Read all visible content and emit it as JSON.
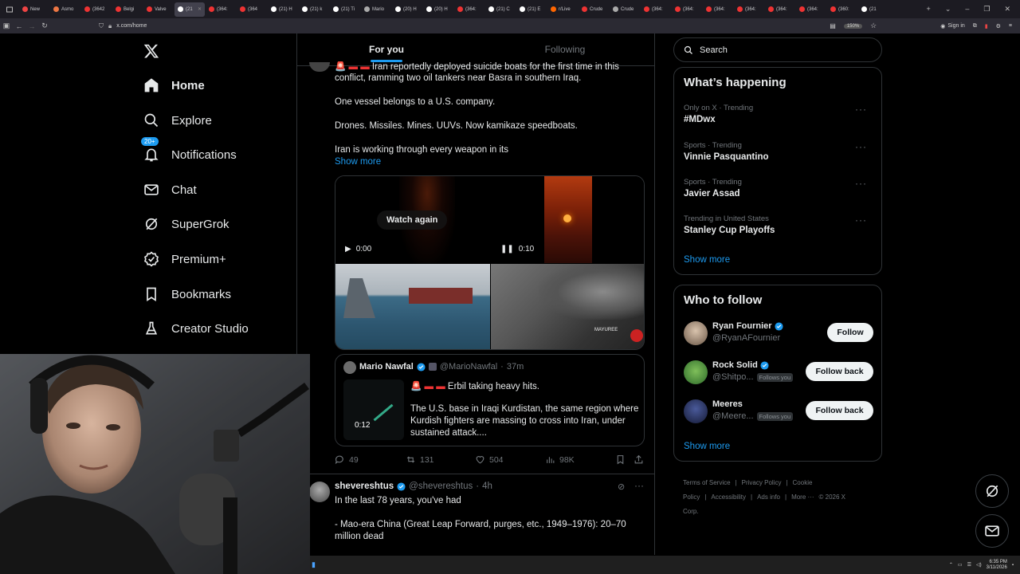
{
  "browser": {
    "tabs": [
      {
        "label": "New",
        "color": "#e44"
      },
      {
        "label": "Asmo",
        "color": "#e74"
      },
      {
        "label": "(3642",
        "color": "#e33"
      },
      {
        "label": "Belgi",
        "color": "#e33"
      },
      {
        "label": "Valve",
        "color": "#e33"
      },
      {
        "label": "(21",
        "color": "#fff",
        "active": true
      },
      {
        "label": "(364:",
        "color": "#e33"
      },
      {
        "label": "(364",
        "color": "#e33"
      },
      {
        "label": "(21) H",
        "color": "#fff"
      },
      {
        "label": "(21) k",
        "color": "#fff"
      },
      {
        "label": "(21) Ti",
        "color": "#fff"
      },
      {
        "label": "Mario",
        "color": "#aaa"
      },
      {
        "label": "(20) H",
        "color": "#fff"
      },
      {
        "label": "(20) H",
        "color": "#fff"
      },
      {
        "label": "(364:",
        "color": "#e33"
      },
      {
        "label": "(21) C",
        "color": "#fff"
      },
      {
        "label": "(21) E",
        "color": "#fff"
      },
      {
        "label": "r/Live",
        "color": "#f60"
      },
      {
        "label": "Crude",
        "color": "#e33"
      },
      {
        "label": "Crude",
        "color": "#aaa"
      },
      {
        "label": "(364:",
        "color": "#e33"
      },
      {
        "label": "(364:",
        "color": "#e33"
      },
      {
        "label": "(364:",
        "color": "#e33"
      },
      {
        "label": "(364:",
        "color": "#e33"
      },
      {
        "label": "(364:",
        "color": "#e33"
      },
      {
        "label": "(364:",
        "color": "#e33"
      },
      {
        "label": "(360:",
        "color": "#e33"
      },
      {
        "label": "(21",
        "color": "#fff"
      }
    ],
    "url": "x.com/home",
    "zoom": "150%",
    "sign_in": "Sign in"
  },
  "nav": {
    "items": [
      {
        "label": "Home",
        "icon": "home-icon"
      },
      {
        "label": "Explore",
        "icon": "search-icon"
      },
      {
        "label": "Notifications",
        "icon": "bell-icon",
        "badge": "20+"
      },
      {
        "label": "Chat",
        "icon": "mail-icon"
      },
      {
        "label": "SuperGrok",
        "icon": "grok-icon"
      },
      {
        "label": "Premium+",
        "icon": "verified-icon"
      },
      {
        "label": "Bookmarks",
        "icon": "bookmark-icon"
      },
      {
        "label": "Creator Studio",
        "icon": "flask-icon"
      }
    ]
  },
  "feed": {
    "tabs": [
      "For you",
      "Following"
    ],
    "post1": {
      "line1": "Iran reportedly deployed suicide boats for the first time in this",
      "line2": "conflict, ramming two oil tankers near Basra in southern Iraq.",
      "para2": "One vessel belongs to a U.S. company.",
      "para3": "Drones. Missiles. Mines. UUVs. Now kamikaze speedboats.",
      "para4": "Iran is working through every weapon in its",
      "show_more": "Show more",
      "video1_time": "0:00",
      "watch_again": "Watch again",
      "video2_time": "0:10",
      "quote": {
        "name": "Mario Nawfal",
        "handle": "@MarioNawfal",
        "time": "37m",
        "line1": "Erbil taking heavy hits.",
        "line2": "The U.S. base in Iraqi Kurdistan, the same region where",
        "line3": "Kurdish fighters are massing to cross into Iran, under",
        "line4": "sustained attack....",
        "video_time": "0:12"
      },
      "stats": {
        "replies": "49",
        "reposts": "131",
        "likes": "504",
        "views": "98K"
      }
    },
    "post2": {
      "name": "shevereshtus",
      "handle": "@shevereshtus",
      "time": "4h",
      "line1": "In the last 78 years, you've had",
      "line2": "- Mao-era China (Great Leap Forward, purges, etc., 1949–1976): 20–70",
      "line3": "million dead"
    }
  },
  "sidebar": {
    "search_placeholder": "Search",
    "happening_title": "What’s happening",
    "trends": [
      {
        "meta": "Only on X · Trending",
        "name": "#MDwx"
      },
      {
        "meta": "Sports · Trending",
        "name": "Vinnie Pasquantino"
      },
      {
        "meta": "Sports · Trending",
        "name": "Javier Assad"
      },
      {
        "meta": "Trending in United States",
        "name": "Stanley Cup Playoffs"
      }
    ],
    "trends_show_more": "Show more",
    "who_title": "Who to follow",
    "who": [
      {
        "name": "Ryan Fournier",
        "handle": "@RyanAFournier",
        "button": "Follow",
        "follows_you": ""
      },
      {
        "name": "Rock Solid",
        "handle": "@Shitpo...",
        "button": "Follow back",
        "follows_you": "Follows you"
      },
      {
        "name": "Meeres",
        "handle": "@Meere...",
        "button": "Follow back",
        "follows_you": "Follows you"
      }
    ],
    "who_show_more": "Show more",
    "footer": [
      "Terms of Service",
      "|",
      "Privacy Policy",
      "|",
      "Cookie Policy",
      "|",
      "Accessibility",
      "|",
      "Ads info",
      "|",
      "More ···",
      "© 2026 X Corp."
    ]
  },
  "taskbar": {
    "time": "6:35 PM",
    "date": "3/11/2026"
  },
  "colors": {
    "accent": "#1d9bf0",
    "bg": "#000000",
    "border": "#2f3336",
    "muted": "#71767b"
  }
}
